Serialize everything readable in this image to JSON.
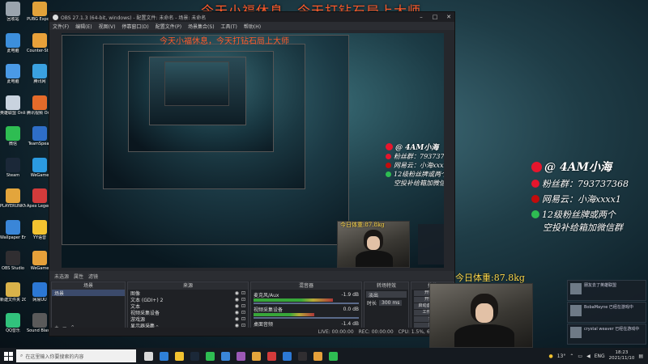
{
  "overlay": {
    "top_title": "今天小福休息，今天打钻石局上大师",
    "preview_title": "今天小福休息，今天打钻石局上大师",
    "handle": "@ 4AM小海",
    "fan_group": "粉丝群：793737368",
    "netease": "网易云：小海xxxx1",
    "promo_line1": "12级粉丝牌或两个",
    "promo_line2": "空投补给箱加微信群",
    "weight": "今日体重:87.8kg"
  },
  "desktop_icons": [
    {
      "label": "回收站",
      "color": "#9aa4ad",
      "col": 0,
      "row": 0
    },
    {
      "label": "PUBG Export",
      "color": "#e2a23a",
      "col": 1,
      "row": 0
    },
    {
      "label": "此电脑",
      "color": "#3c8fdc",
      "col": 0,
      "row": 1
    },
    {
      "label": "Counter-Strike Global Of",
      "color": "#e8a13a",
      "col": 1,
      "row": 1
    },
    {
      "label": "此电脑",
      "color": "#4a9ae6",
      "col": 0,
      "row": 2
    },
    {
      "label": "腾讯网",
      "color": "#3aa1e0",
      "col": 1,
      "row": 2
    },
    {
      "label": "英雄联盟 Online",
      "color": "#c9d3df",
      "col": 0,
      "row": 3
    },
    {
      "label": "腾讯视频 Online",
      "color": "#e36b2a",
      "col": 1,
      "row": 3
    },
    {
      "label": "微信",
      "color": "#2ebd52",
      "col": 0,
      "row": 4
    },
    {
      "label": "TeamSpeak",
      "color": "#2e6ec7",
      "col": 1,
      "row": 4
    },
    {
      "label": "Steam",
      "color": "#1b2838",
      "col": 0,
      "row": 5
    },
    {
      "label": "WeGame",
      "color": "#2b9ae0",
      "col": 1,
      "row": 5
    },
    {
      "label": "PLAYERUNKNOWN'S BATTLEGR",
      "color": "#e3a53c",
      "col": 0,
      "row": 6
    },
    {
      "label": "Apex Legends",
      "color": "#d33b3b",
      "col": 1,
      "row": 6
    },
    {
      "label": "Wallpaper Engine",
      "color": "#3a86d8",
      "col": 0,
      "row": 7
    },
    {
      "label": "YY语音",
      "color": "#f2c230",
      "col": 1,
      "row": 7
    },
    {
      "label": "OBS Studio",
      "color": "#302e31",
      "col": 0,
      "row": 8
    },
    {
      "label": "WeGame",
      "color": "#e5a03a",
      "col": 1,
      "row": 8
    },
    {
      "label": "新建文件夹 20210101",
      "color": "#d9b24a",
      "col": 0,
      "row": 9
    },
    {
      "label": "网易UU",
      "color": "#2c78d4",
      "col": 1,
      "row": 9
    },
    {
      "label": "QQ音乐",
      "color": "#31c27c",
      "col": 0,
      "row": 10
    },
    {
      "label": "Sound Blaster",
      "color": "#5a5a5a",
      "col": 1,
      "row": 10
    }
  ],
  "obs": {
    "title": "OBS 27.1.3 (64-bit, windows) - 配置文件: 未命名 - 场景: 未命名",
    "menu": [
      "文件(F)",
      "编辑(E)",
      "视图(V)",
      "停靠窗口(D)",
      "配置文件(P)",
      "场景集合(S)",
      "工具(T)",
      "帮助(H)"
    ],
    "status_row": [
      "未选源",
      "属性",
      "滤镜"
    ],
    "docks": {
      "scenes": {
        "title": "场景",
        "items": [
          "场景"
        ]
      },
      "sources": {
        "title": "来源",
        "items": [
          "图像",
          "文本 (GDI+) 2",
          "文本",
          "视频采集设备",
          "游戏源",
          "显示器采集"
        ]
      },
      "mixer": {
        "title": "混音器",
        "items": [
          {
            "name": "麦克风/Aux",
            "db": "-1.9 dB",
            "level": 0.72
          },
          {
            "name": "视频采集设备",
            "db": "0.0 dB",
            "level": 0.55
          },
          {
            "name": "桌面音频",
            "db": "-1.4 dB",
            "level": 0.62
          }
        ]
      },
      "transitions": {
        "title": "转场特效",
        "fade": "淡出",
        "duration_label": "时长",
        "duration": "300 ms"
      },
      "controls": {
        "title": "控件",
        "buttons": [
          "开始推流",
          "开始录制",
          "启动虚拟摄像机",
          "工作室模式",
          "设置",
          "退出"
        ]
      }
    },
    "statusbar": [
      "LIVE: 00:00:00",
      "REC: 00:00:00",
      "CPU: 1.5%, 60.00 fps"
    ]
  },
  "notifications": [
    {
      "text": "朋友去了英雄联盟"
    },
    {
      "text": "BobaMayne 已经在游戏中"
    },
    {
      "text": "crystal weaver 已经在游戏中"
    }
  ],
  "taskbar": {
    "search_placeholder": "在这里输入你要搜索的内容",
    "apps": [
      "#d9d9d9",
      "#2f80d8",
      "#f2c230",
      "#1b2838",
      "#2ebd52",
      "#3a86d8",
      "#9b59b6",
      "#e3a53c",
      "#d33b3b",
      "#2c78d4",
      "#302e31",
      "#e5a03a",
      "#2ebd52"
    ],
    "weather": "13°",
    "lang": "ENG",
    "time": "18:23",
    "date": "2021/11/10"
  }
}
